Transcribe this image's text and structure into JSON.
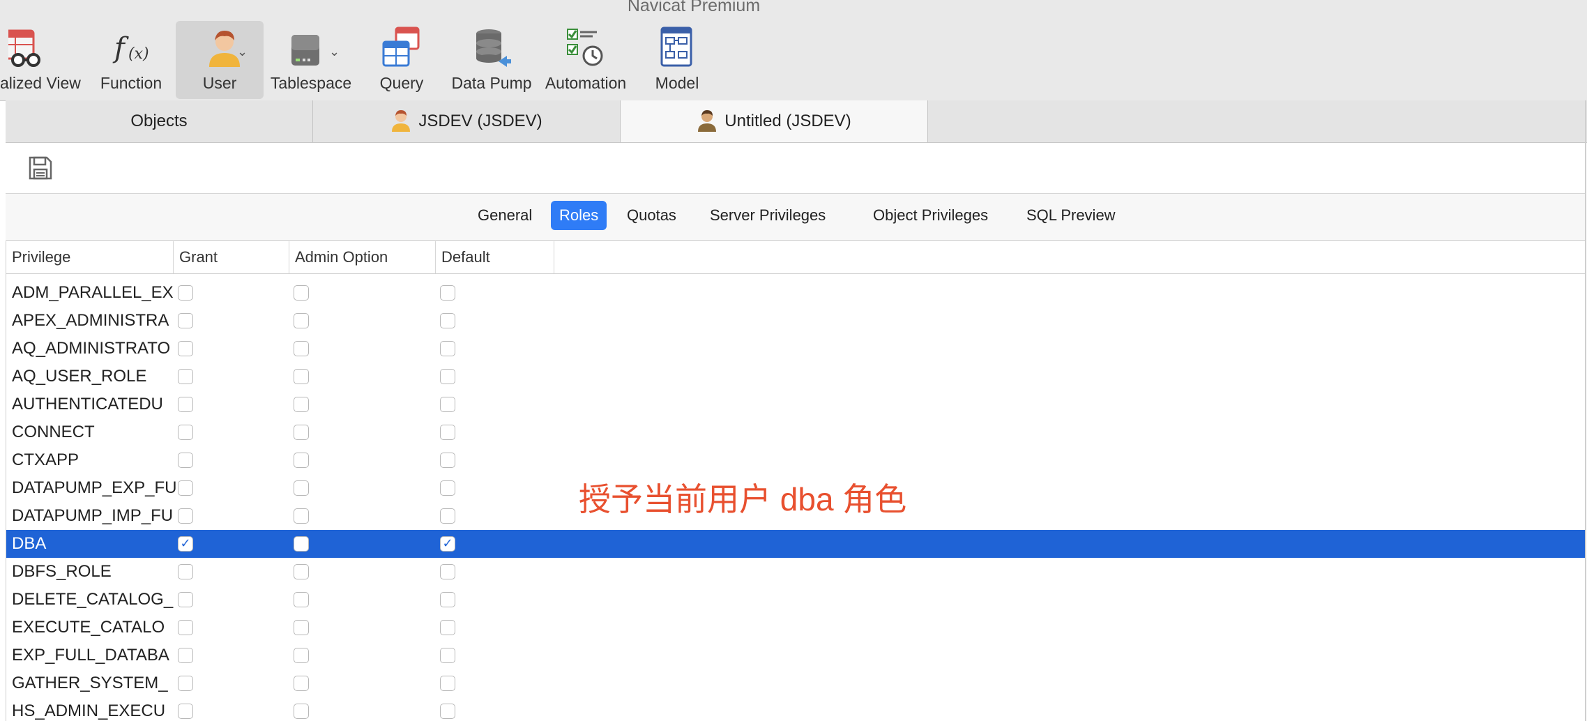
{
  "app": {
    "title": "Navicat Premium"
  },
  "toolbar": {
    "items": [
      {
        "label": "alized View",
        "icon": "materialized-view-icon"
      },
      {
        "label": "Function",
        "icon": "function-icon"
      },
      {
        "label": "User",
        "icon": "user-icon",
        "active": true
      },
      {
        "label": "Tablespace",
        "icon": "tablespace-icon"
      },
      {
        "label": "Query",
        "icon": "query-icon"
      },
      {
        "label": "Data Pump",
        "icon": "data-pump-icon"
      },
      {
        "label": "Automation",
        "icon": "automation-icon"
      },
      {
        "label": "Model",
        "icon": "model-icon"
      }
    ]
  },
  "tabs": [
    {
      "label": "Objects"
    },
    {
      "label": "JSDEV (JSDEV)",
      "icon": "user-icon"
    },
    {
      "label": "Untitled (JSDEV)",
      "icon": "user-icon",
      "active": true
    }
  ],
  "segments": [
    {
      "label": "General"
    },
    {
      "label": "Roles",
      "active": true
    },
    {
      "label": "Quotas"
    },
    {
      "label": "Server Privileges"
    },
    {
      "label": "Object Privileges"
    },
    {
      "label": "SQL Preview"
    }
  ],
  "grid": {
    "columns": [
      "Privilege",
      "Grant",
      "Admin Option",
      "Default"
    ],
    "rows": [
      {
        "name": "ADM_PARALLEL_EX",
        "grant": false,
        "admin": false,
        "default": false
      },
      {
        "name": "APEX_ADMINISTRA",
        "grant": false,
        "admin": false,
        "default": false
      },
      {
        "name": "AQ_ADMINISTRATO",
        "grant": false,
        "admin": false,
        "default": false
      },
      {
        "name": "AQ_USER_ROLE",
        "grant": false,
        "admin": false,
        "default": false
      },
      {
        "name": "AUTHENTICATEDU",
        "grant": false,
        "admin": false,
        "default": false
      },
      {
        "name": "CONNECT",
        "grant": false,
        "admin": false,
        "default": false
      },
      {
        "name": "CTXAPP",
        "grant": false,
        "admin": false,
        "default": false
      },
      {
        "name": "DATAPUMP_EXP_FU",
        "grant": false,
        "admin": false,
        "default": false
      },
      {
        "name": "DATAPUMP_IMP_FU",
        "grant": false,
        "admin": false,
        "default": false
      },
      {
        "name": "DBA",
        "grant": true,
        "admin": false,
        "default": true,
        "selected": true
      },
      {
        "name": "DBFS_ROLE",
        "grant": false,
        "admin": false,
        "default": false
      },
      {
        "name": "DELETE_CATALOG_",
        "grant": false,
        "admin": false,
        "default": false
      },
      {
        "name": "EXECUTE_CATALO",
        "grant": false,
        "admin": false,
        "default": false
      },
      {
        "name": "EXP_FULL_DATABA",
        "grant": false,
        "admin": false,
        "default": false
      },
      {
        "name": "GATHER_SYSTEM_",
        "grant": false,
        "admin": false,
        "default": false
      },
      {
        "name": "HS_ADMIN_EXECU",
        "grant": false,
        "admin": false,
        "default": false
      }
    ]
  },
  "annotation": {
    "text": "授予当前用户 dba 角色",
    "color": "#e8502f"
  },
  "colors": {
    "accent": "#2f7cf6",
    "selection": "#1f63d6"
  }
}
